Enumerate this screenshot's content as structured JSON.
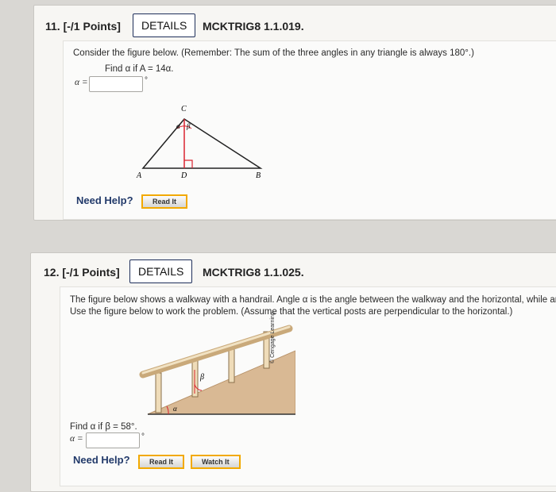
{
  "q11": {
    "number": "11.",
    "points": "[-/1 Points]",
    "details": "DETAILS",
    "code": "MCKTRIG8 1.1.019.",
    "prompt": "Consider the figure below. (Remember: The sum of the three angles in any triangle is always 180°.)",
    "find_text": "Find α if A = 14α.",
    "answer_label": "α =",
    "answer_value": "",
    "degree": "°",
    "figure_labels": {
      "c": "C",
      "a": "A",
      "d": "D",
      "b": "B",
      "alpha": "α",
      "beta": "β"
    },
    "need_help": "Need Help?",
    "read_it": "Read It"
  },
  "q12": {
    "number": "12.",
    "points": "[-/1 Points]",
    "details": "DETAILS",
    "code": "MCKTRIG8 1.1.025.",
    "prompt_line1": "The figure below shows a walkway with a handrail. Angle α is the angle between the walkway and the horizontal, while an",
    "prompt_line2": "Use the figure below to work the problem. (Assume that the vertical posts are perpendicular to the horizontal.)",
    "find_text": "Find α if β = 58°.",
    "answer_label": "α =",
    "answer_value": "",
    "degree": "°",
    "figure_labels": {
      "alpha": "α",
      "beta": "β",
      "credit": "© Cengage Learning"
    },
    "need_help": "Need Help?",
    "read_it": "Read It",
    "watch_it": "Watch It"
  },
  "colors": {
    "accent_button_border": "#f2a900",
    "need_help": "#223a6a",
    "walkway": "#d9b994",
    "rail": "#e8d3ab"
  }
}
